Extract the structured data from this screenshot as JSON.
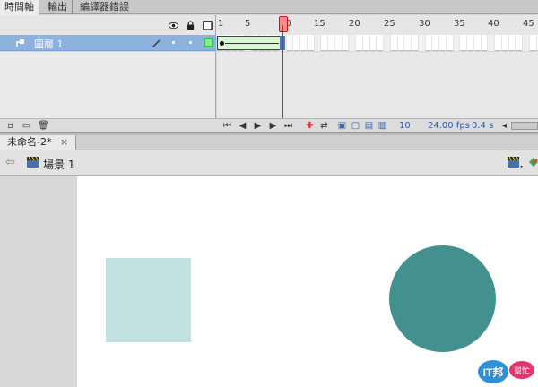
{
  "panel_tabs": [
    {
      "label": "時間軸",
      "active": true
    },
    {
      "label": "輸出",
      "active": false
    },
    {
      "label": "編譯器錯誤",
      "active": false
    }
  ],
  "timeline": {
    "ruler_labels": [
      "1",
      "5",
      "10",
      "15",
      "20",
      "25",
      "30",
      "35",
      "40",
      "45"
    ],
    "current_frame": 10,
    "layer": {
      "name": "圖層 1",
      "outline_color": "#22cc44"
    },
    "tween_fill_color": "#d6f7cf",
    "playhead_color": "#e02020"
  },
  "status": {
    "current_frame": "10",
    "fps": "24.00 fps",
    "elapsed": "0.4 s"
  },
  "document": {
    "tab_title": "未命名-2*"
  },
  "scene": {
    "label": "場景 1"
  },
  "stage": {
    "square_color": "#c2e1e1",
    "circle_color": "#43918e"
  },
  "watermark": {
    "text": "IT邦",
    "subtext": "幫忙"
  }
}
